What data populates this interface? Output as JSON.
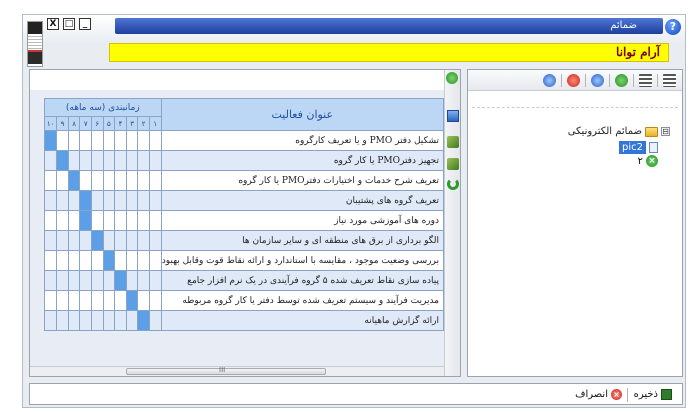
{
  "window": {
    "title": "ضمائم",
    "banner": "آرام توانا",
    "controls": {
      "close": "X",
      "maximize": "□",
      "minimize": "_"
    },
    "help": "?"
  },
  "tree": {
    "root_label": "ضمائم الکترونیکی",
    "root_expander": "⊟",
    "children": [
      "pic2",
      "۲"
    ],
    "toolbar_icons": [
      "list-icon",
      "indent-icon",
      "add-icon",
      "refresh-icon",
      "remove-icon",
      "undo-icon"
    ]
  },
  "gantt": {
    "header_title": "عنوان فعالیت",
    "header_time": "زمانبندی (سه ماهه)",
    "columns": [
      "۱",
      "۲",
      "۳",
      "۴",
      "۵",
      "۶",
      "۷",
      "۸",
      "۹",
      "۱۰"
    ],
    "tasks": [
      {
        "label": "تشکیل دفتر PMO و یا تعریف کارگروه",
        "filled": 10
      },
      {
        "label": "تجهیز دفترPMO   یا کار گروه",
        "filled": 9
      },
      {
        "label": "تعریف شرح خدمات و اختیارات دفترPMO   یا کار گروه",
        "filled": 8
      },
      {
        "label": "تعریف گروه های پشتیبان",
        "filled": 7
      },
      {
        "label": "دوره های آموزشی مورد نیاز",
        "filled": 7
      },
      {
        "label": "الگو برداری از برق های منطقه ای و سایر سازمان ها",
        "filled": 6
      },
      {
        "label": "بررسی وضعیت موجود ، مقایسه با استاندارد و ارائه نقاط قوت وقابل بهبود",
        "filled": 5
      },
      {
        "label": "پیاده سازی نقاط تعریف شده ۵ گروه فرآیندی در یک نرم افزار جامع",
        "filled": 4
      },
      {
        "label": "مدیریت فرآیند و سیستم تعریف شده توسط دفتر یا کار گروه مربوطه",
        "filled": 3
      },
      {
        "label": "ارائه گزارش ماهیانه",
        "filled": 2
      }
    ],
    "scroll_hint": "III"
  },
  "actions": {
    "save_label": "ذخیره",
    "cancel_label": "انصراف"
  }
}
